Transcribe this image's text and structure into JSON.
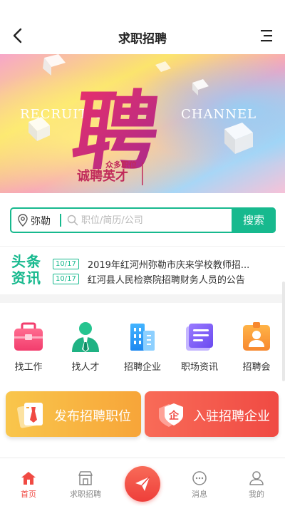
{
  "header": {
    "title": "求职招聘"
  },
  "banner": {
    "big_char": "聘",
    "left_text": "RECRUITM",
    "right_text": "CHANNEL",
    "small_text": "众多职位",
    "slogan": "诚聘英才"
  },
  "search": {
    "city": "弥勒",
    "placeholder": "职位/简历/公司",
    "button_label": "搜索"
  },
  "news": {
    "logo_line1": "头条",
    "logo_line2": "资讯",
    "items": [
      {
        "date": "10/17",
        "text": "2019年红河州弥勒市庆来学校教师招..."
      },
      {
        "date": "10/17",
        "text": "红河县人民检察院招聘财务人员的公告"
      }
    ]
  },
  "grid": {
    "items": [
      {
        "label": "找工作",
        "icon": "briefcase-icon"
      },
      {
        "label": "找人才",
        "icon": "person-tie-icon"
      },
      {
        "label": "招聘企业",
        "icon": "buildings-icon"
      },
      {
        "label": "职场资讯",
        "icon": "news-card-icon"
      },
      {
        "label": "招聘会",
        "icon": "id-badge-icon"
      }
    ]
  },
  "actions": {
    "publish_label": "发布招聘职位",
    "join_label": "入驻招聘企业",
    "join_icon_char": "企"
  },
  "bottom_nav": {
    "items": [
      {
        "label": "首页",
        "icon": "home-icon",
        "active": true
      },
      {
        "label": "求职招聘",
        "icon": "shop-icon",
        "active": false
      },
      {
        "label": "消息",
        "icon": "chat-icon",
        "active": false
      },
      {
        "label": "我的",
        "icon": "user-icon",
        "active": false
      }
    ]
  },
  "colors": {
    "primary_green": "#17b98e",
    "accent_red": "#f04a43",
    "accent_orange": "#f7a539"
  }
}
